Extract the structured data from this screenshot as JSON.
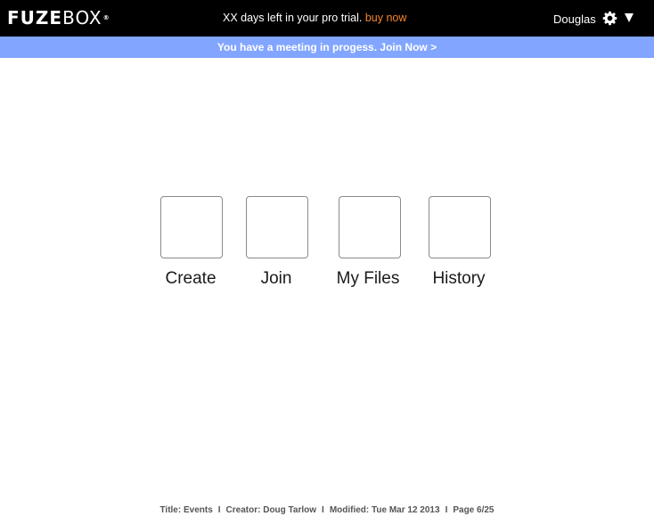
{
  "header": {
    "logo_main": "FUZE",
    "logo_box": "BOX",
    "logo_mark": "®",
    "trial_text": "XX days left in your pro trial.",
    "buy_label": "buy now",
    "user_name": "Douglas",
    "settings_icon": "gear-icon",
    "menu_icon": "caret-down-icon"
  },
  "banner": {
    "text": "You have a meeting in progess. Join Now >"
  },
  "tiles": [
    {
      "label": "Create"
    },
    {
      "label": "Join"
    },
    {
      "label": "My Files"
    },
    {
      "label": "History"
    }
  ],
  "footer": {
    "title": "Title: Events",
    "creator": "Creator: Doug Tarlow",
    "modified": "Modified: Tue Mar 12 2013",
    "page": "Page 6/25",
    "separator": "I"
  },
  "colors": {
    "topbar": "#000000",
    "banner": "#82a6ff",
    "buy_link": "#f3862f"
  }
}
